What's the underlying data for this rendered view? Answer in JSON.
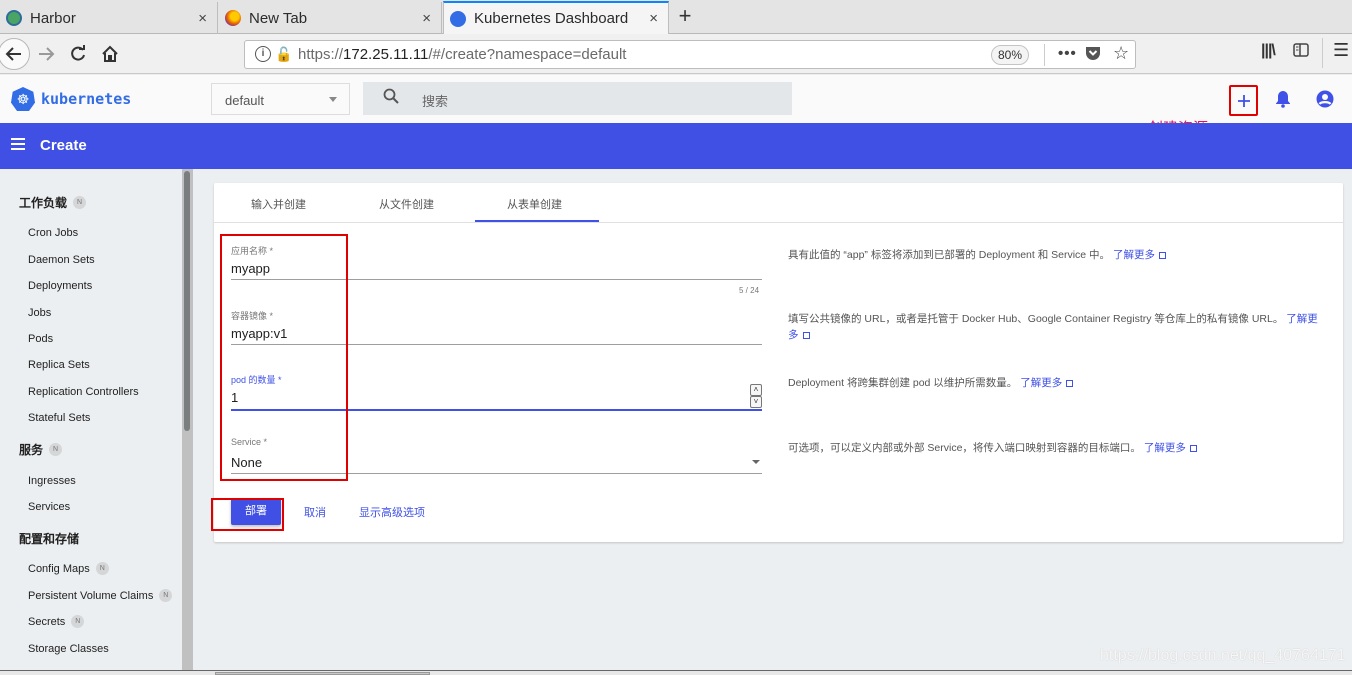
{
  "browser": {
    "tabs": [
      {
        "title": "Harbor",
        "icon": "harbor-icon",
        "active": false
      },
      {
        "title": "New Tab",
        "icon": "firefox-icon",
        "active": false
      },
      {
        "title": "Kubernetes Dashboard",
        "icon": "kubernetes-icon",
        "active": true
      }
    ],
    "close_glyph": "×",
    "new_tab_glyph": "+",
    "url_prefix": "https://",
    "url_host": "172.25.11.11",
    "url_path": "/#/create?namespace=default",
    "zoom_level": "80%"
  },
  "header": {
    "brand": "kubernetes",
    "namespace": "default",
    "search_placeholder": "搜索",
    "create_icon": "plus-icon",
    "annotation": "创建资源"
  },
  "toolbar": {
    "title": "Create"
  },
  "sidebar": {
    "sections": [
      {
        "title": "工作负载",
        "badge": "N",
        "items": [
          {
            "label": "Cron Jobs"
          },
          {
            "label": "Daemon Sets"
          },
          {
            "label": "Deployments"
          },
          {
            "label": "Jobs"
          },
          {
            "label": "Pods"
          },
          {
            "label": "Replica Sets"
          },
          {
            "label": "Replication Controllers"
          },
          {
            "label": "Stateful Sets"
          }
        ]
      },
      {
        "title": "服务",
        "badge": "N",
        "items": [
          {
            "label": "Ingresses"
          },
          {
            "label": "Services"
          }
        ]
      },
      {
        "title": "配置和存储",
        "items": [
          {
            "label": "Config Maps",
            "badge": "N"
          },
          {
            "label": "Persistent Volume Claims",
            "badge": "N"
          },
          {
            "label": "Secrets",
            "badge": "N"
          },
          {
            "label": "Storage Classes"
          }
        ]
      }
    ]
  },
  "create": {
    "tabs": [
      {
        "label": "输入并创建"
      },
      {
        "label": "从文件创建"
      },
      {
        "label": "从表单创建",
        "active": true
      }
    ],
    "form": {
      "app_name": {
        "label": "应用名称 *",
        "value": "myapp",
        "counter": "5 / 24"
      },
      "image": {
        "label": "容器镜像 *",
        "value": "myapp:v1"
      },
      "pods": {
        "label": "pod 的数量 *",
        "value": "1"
      },
      "service": {
        "label": "Service *",
        "value": "None"
      }
    },
    "help": {
      "app_name": "具有此值的 “app” 标签将添加到已部署的 Deployment 和 Service 中。",
      "image": "填写公共镜像的 URL，或者是托管于 Docker Hub、Google Container Registry 等仓库上的私有镜像 URL。",
      "pods": "Deployment 将跨集群创建 pod 以维护所需数量。",
      "service": "可选项，可以定义内部或外部 Service，将传入端口映射到容器的目标端口。",
      "learn_more": "了解更多"
    },
    "actions": {
      "deploy": "部署",
      "cancel": "取消",
      "advanced": "显示高级选项"
    }
  },
  "watermark": "https://blog.csdn.net/qq_40764171",
  "colors": {
    "accent": "#4150e4",
    "annotation_red": "#e00000"
  }
}
